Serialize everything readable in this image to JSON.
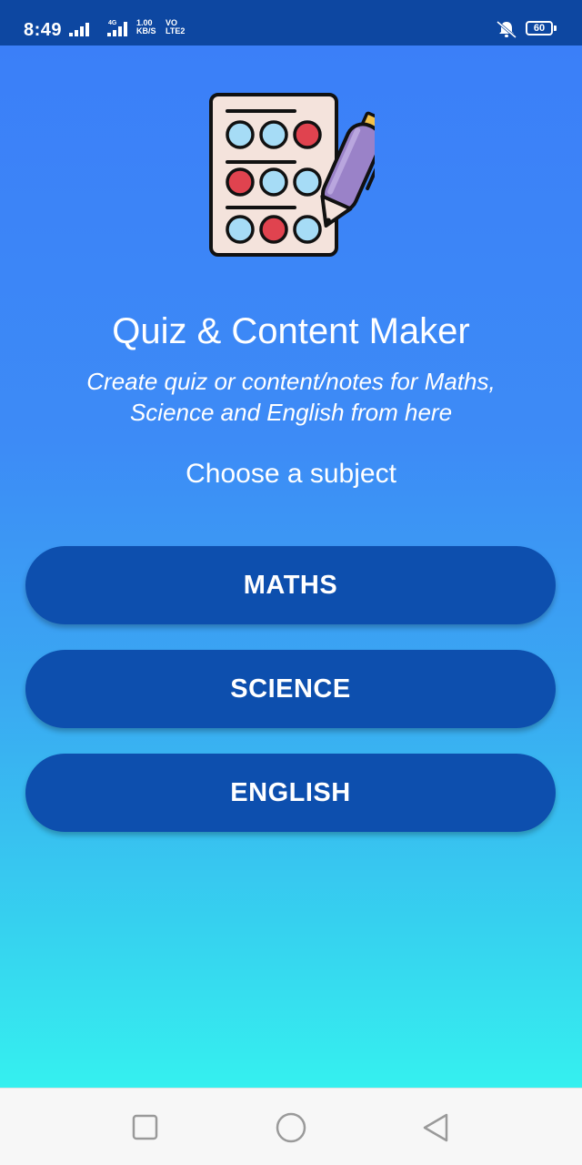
{
  "status_bar": {
    "time": "8:49",
    "network_type": "4G",
    "speed_value": "1.00",
    "speed_unit": "KB/S",
    "volte_top": "VO",
    "volte_bottom": "LTE2",
    "battery_level": "60",
    "icons": [
      "signal-icon",
      "network-4g-icon",
      "volte-icon",
      "bell-off-icon",
      "battery-icon"
    ]
  },
  "header": {
    "logo_icon": "quiz-sheet-pen-icon",
    "title": "Quiz & Content Maker",
    "subtitle": "Create quiz or content/notes for Maths, Science and English from here",
    "prompt": "Choose a subject"
  },
  "subjects": [
    {
      "label": "MATHS"
    },
    {
      "label": "SCIENCE"
    },
    {
      "label": "ENGLISH"
    }
  ],
  "colors": {
    "status_bar": "#0d47a1",
    "gradient_top": "#3b7ff8",
    "gradient_bottom": "#35f0ef",
    "button": "#0d4fae",
    "nav_bar": "#f7f7f7"
  },
  "nav_bar": {
    "icons": [
      "recent-apps-icon",
      "home-icon",
      "back-icon"
    ]
  }
}
